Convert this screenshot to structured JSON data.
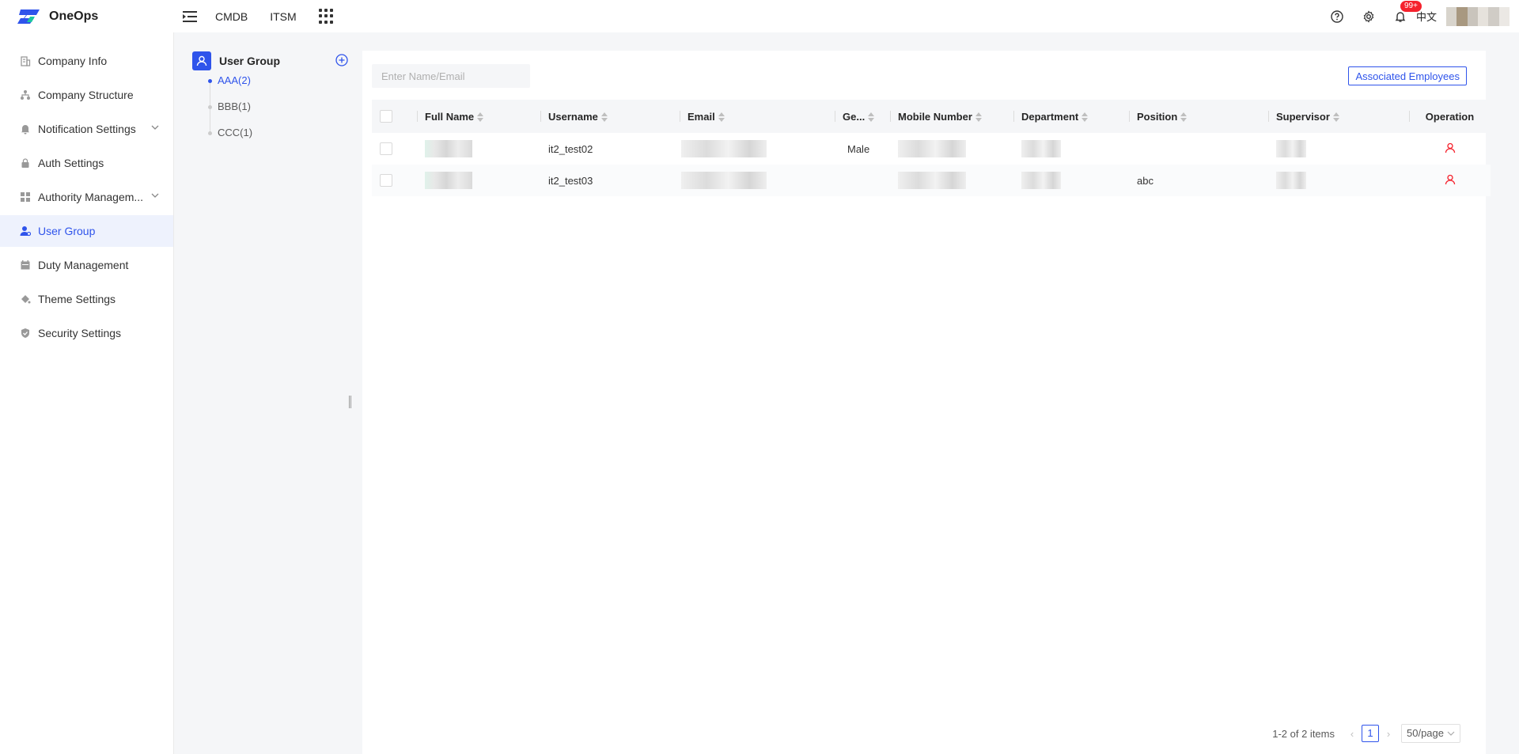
{
  "header": {
    "app_name": "OneOps",
    "nav": [
      "CMDB",
      "ITSM"
    ],
    "notifications_badge": "99+",
    "language": "中文"
  },
  "sidebar": {
    "items": [
      {
        "label": "Company Info",
        "icon": "building-icon"
      },
      {
        "label": "Company Structure",
        "icon": "org-chart-icon"
      },
      {
        "label": "Notification Settings",
        "icon": "bell-icon"
      },
      {
        "label": "Auth Settings",
        "icon": "lock-icon"
      },
      {
        "label": "Authority Managem...",
        "icon": "grid-apps-icon"
      },
      {
        "label": "User Group",
        "icon": "user-group-icon"
      },
      {
        "label": "Duty Management",
        "icon": "calendar-icon"
      },
      {
        "label": "Theme Settings",
        "icon": "paint-bucket-icon"
      },
      {
        "label": "Security Settings",
        "icon": "shield-icon"
      }
    ],
    "active": "User Group"
  },
  "group_panel": {
    "title": "User Group",
    "groups": [
      "AAA(2)",
      "BBB(1)",
      "CCC(1)"
    ],
    "selected": "AAA(2)"
  },
  "main": {
    "search_placeholder": "Enter Name/Email",
    "associate_button": "Associated Employees",
    "columns": [
      "Full Name",
      "Username",
      "Email",
      "Ge...",
      "Mobile Number",
      "Department",
      "Position",
      "Supervisor",
      "Operation"
    ],
    "rows": [
      {
        "username": "it2_test02",
        "gender": "Male",
        "position": ""
      },
      {
        "username": "it2_test03",
        "gender": "",
        "position": "abc"
      }
    ],
    "pagination": {
      "summary": "1-2 of 2 items",
      "current_page": "1",
      "page_size": "50/page"
    }
  },
  "colors": {
    "accent": "#2f54eb",
    "danger": "#f5222d"
  }
}
